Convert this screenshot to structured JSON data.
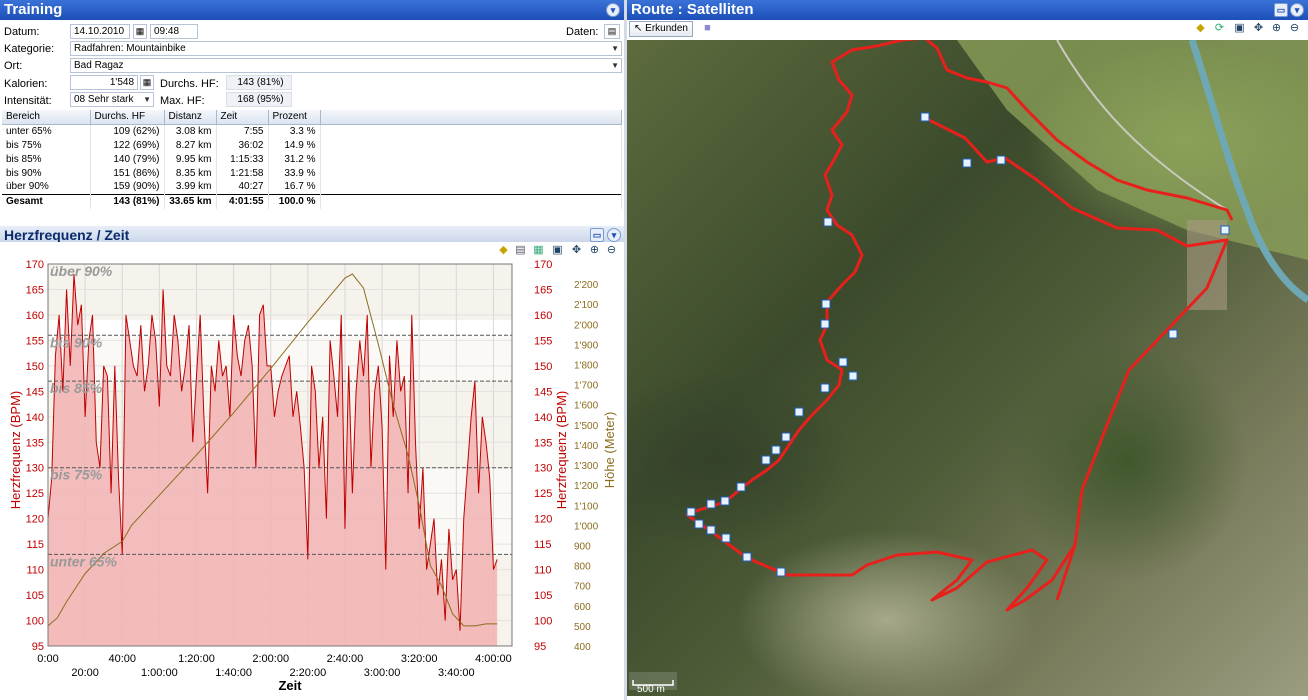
{
  "training": {
    "title": "Training",
    "datum_label": "Datum:",
    "date": "14.10.2010",
    "time": "09:48",
    "daten_label": "Daten:",
    "kategorie_label": "Kategorie:",
    "kategorie": "Radfahren: Mountainbike",
    "ort_label": "Ort:",
    "ort": "Bad Ragaz",
    "kalorien_label": "Kalorien:",
    "kalorien": "1'548",
    "intensitaet_label": "Intensität:",
    "intensitaet": "08 Sehr stark",
    "durchs_hf_label": "Durchs. HF:",
    "durchs_hf": "143 (81%)",
    "max_hf_label": "Max. HF:",
    "max_hf": "168 (95%)"
  },
  "zones": {
    "headers": [
      "Bereich",
      "Durchs. HF",
      "Distanz",
      "Zeit",
      "Prozent"
    ],
    "rows": [
      [
        "unter 65%",
        "109 (62%)",
        "3.08 km",
        "7:55",
        "3.3 %"
      ],
      [
        "bis 75%",
        "122 (69%)",
        "8.27 km",
        "36:02",
        "14.9 %"
      ],
      [
        "bis 85%",
        "140 (79%)",
        "9.95 km",
        "1:15:33",
        "31.2 %"
      ],
      [
        "bis 90%",
        "151 (86%)",
        "8.35 km",
        "1:21:58",
        "33.9 %"
      ],
      [
        "über 90%",
        "159 (90%)",
        "3.99 km",
        "40:27",
        "16.7 %"
      ]
    ],
    "total": [
      "Gesamt",
      "143 (81%)",
      "33.65 km",
      "4:01:55",
      "100.0 %"
    ]
  },
  "chart_panel": {
    "title": "Herzfrequenz / Zeit"
  },
  "chart_data": {
    "type": "line",
    "xlabel": "Zeit",
    "ylabel": "Herzfrequenz (BPM)",
    "y2label": "Höhe (Meter)",
    "ylim": [
      95,
      170
    ],
    "y2lim": [
      400,
      2300
    ],
    "xlim_min": [
      0,
      250
    ],
    "x_ticks_top": [
      "0:00",
      "40:00",
      "1:20:00",
      "2:00:00",
      "2:40:00",
      "3:20:00",
      "4:00:00"
    ],
    "x_ticks_bottom": [
      "20:00",
      "1:00:00",
      "1:40:00",
      "2:20:00",
      "3:00:00",
      "3:40:00"
    ],
    "y_ticks": [
      "170",
      "165",
      "160",
      "155",
      "150",
      "145",
      "140",
      "135",
      "130",
      "125",
      "120",
      "115",
      "110",
      "105",
      "100",
      "95"
    ],
    "y2_ticks": [
      "2'200",
      "2'100",
      "2'000",
      "1'900",
      "1'800",
      "1'700",
      "1'600",
      "1'500",
      "1'400",
      "1'300",
      "1'200",
      "1'100",
      "1'000",
      "900",
      "800",
      "700",
      "600",
      "500",
      "400"
    ],
    "zones": [
      {
        "name": "über 90%",
        "min": 159,
        "max": 170
      },
      {
        "name": "bis 90%",
        "min": 147,
        "max": 156
      },
      {
        "name": "bis 85%",
        "min": 130,
        "max": 147
      },
      {
        "name": "bis 75%",
        "min": 113,
        "max": 130
      },
      {
        "name": "unter 65%",
        "min": 95,
        "max": 113
      }
    ],
    "zone_lines": [
      156,
      147,
      130,
      113
    ],
    "series": [
      {
        "name": "Herzfrequenz",
        "color": "#c00000",
        "x": [
          0,
          2,
          4,
          6,
          8,
          10,
          12,
          14,
          16,
          18,
          20,
          22,
          24,
          26,
          28,
          30,
          32,
          34,
          36,
          38,
          40,
          42,
          44,
          46,
          48,
          50,
          52,
          54,
          56,
          58,
          60,
          62,
          64,
          66,
          68,
          70,
          72,
          74,
          76,
          78,
          80,
          82,
          84,
          86,
          88,
          90,
          92,
          94,
          96,
          98,
          100,
          102,
          104,
          106,
          108,
          110,
          112,
          114,
          116,
          118,
          120,
          122,
          124,
          126,
          128,
          130,
          132,
          134,
          136,
          138,
          140,
          142,
          144,
          146,
          148,
          150,
          152,
          154,
          156,
          158,
          160,
          162,
          164,
          166,
          168,
          170,
          172,
          174,
          176,
          178,
          180,
          182,
          184,
          186,
          188,
          190,
          192,
          194,
          196,
          198,
          200,
          202,
          204,
          206,
          208,
          210,
          212,
          214,
          216,
          218,
          220,
          222,
          224,
          226,
          228,
          230,
          232,
          234,
          236,
          238,
          240,
          242
        ],
        "values": [
          120,
          128,
          152,
          160,
          145,
          165,
          150,
          168,
          158,
          162,
          140,
          155,
          160,
          135,
          130,
          150,
          148,
          125,
          150,
          128,
          113,
          160,
          155,
          150,
          148,
          158,
          145,
          150,
          160,
          155,
          142,
          165,
          150,
          148,
          160,
          155,
          145,
          150,
          158,
          135,
          148,
          160,
          140,
          125,
          150,
          145,
          155,
          148,
          150,
          140,
          160,
          152,
          148,
          155,
          158,
          150,
          130,
          160,
          162,
          150,
          150,
          140,
          145,
          148,
          150,
          152,
          140,
          145,
          138,
          130,
          112,
          150,
          145,
          130,
          140,
          120,
          155,
          148,
          140,
          160,
          118,
          150,
          125,
          145,
          155,
          148,
          160,
          130,
          145,
          150,
          138,
          110,
          152,
          140,
          155,
          145,
          148,
          125,
          160,
          135,
          118,
          130,
          110,
          115,
          120,
          105,
          112,
          100,
          118,
          108,
          110,
          98,
          120,
          130,
          140,
          147,
          125,
          140,
          135,
          128,
          110,
          112
        ]
      },
      {
        "name": "Höhe",
        "color": "#8c6d1f",
        "x": [
          0,
          5,
          10,
          20,
          30,
          40,
          45,
          60,
          80,
          100,
          120,
          140,
          150,
          160,
          164,
          170,
          178,
          186,
          194,
          200,
          206,
          212,
          218,
          224,
          230,
          236,
          242
        ],
        "values": [
          500,
          540,
          620,
          760,
          860,
          920,
          1000,
          1150,
          1350,
          1560,
          1780,
          2010,
          2120,
          2230,
          2250,
          2180,
          1900,
          1600,
          1350,
          1100,
          800,
          700,
          560,
          500,
          500,
          510,
          510
        ]
      }
    ]
  },
  "route": {
    "title": "Route : Satelliten",
    "erkunden_label": "Erkunden",
    "scale_label": "500 m"
  },
  "colors": {
    "title_bar": "#1c4fb8",
    "hr_line": "#c00000",
    "altitude_line": "#8c6d1f",
    "zone_fill": "#f2b3b3",
    "route": "#e8201c"
  }
}
